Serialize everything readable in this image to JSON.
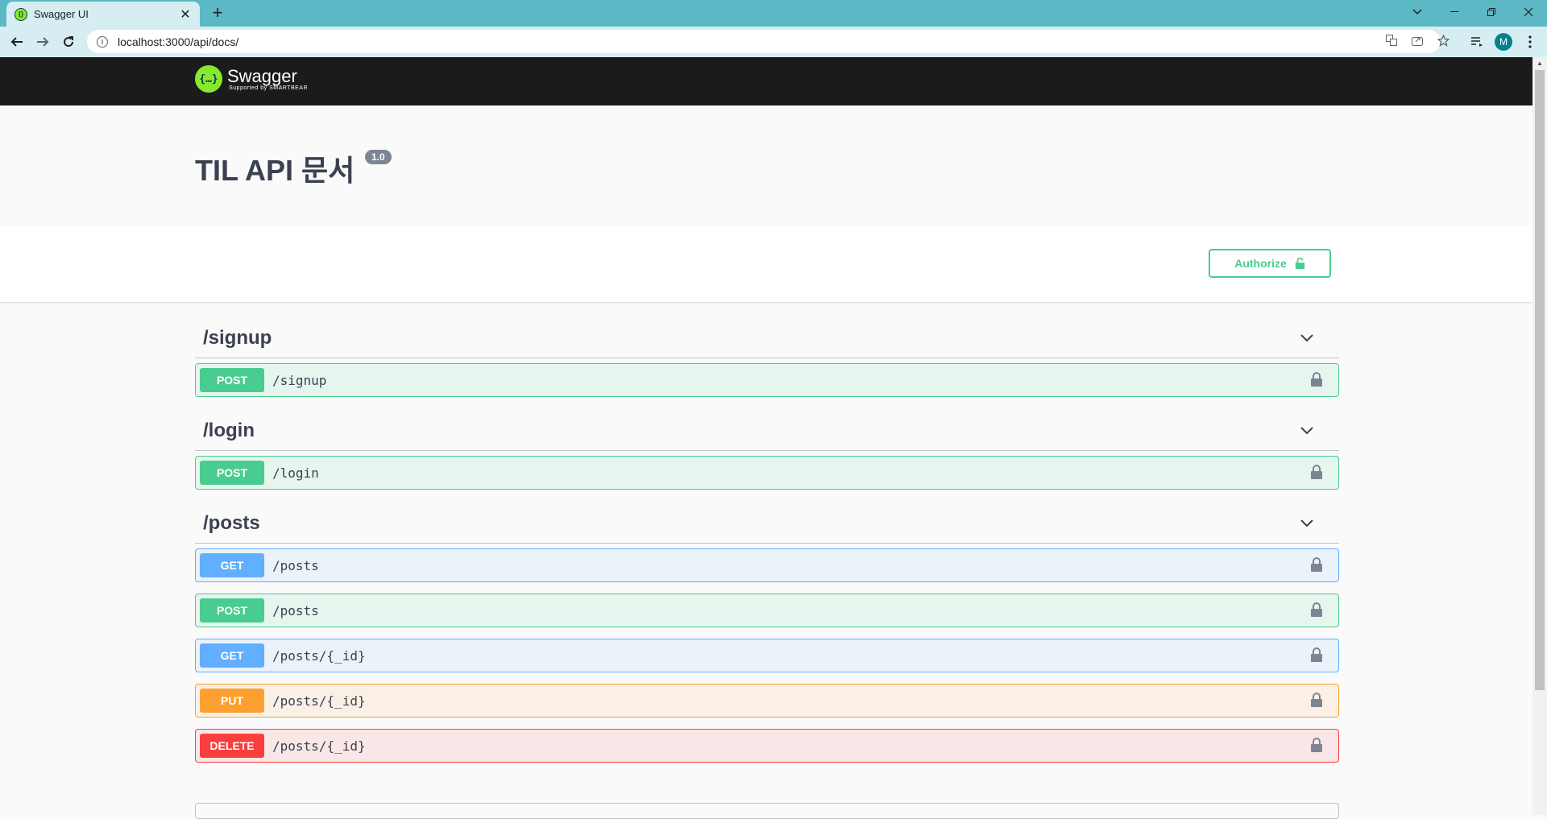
{
  "browser": {
    "tab_title": "Swagger UI",
    "tab_close": "✕",
    "new_tab": "+",
    "url": "localhost:3000/api/docs/",
    "profile_initial": "M"
  },
  "swagger": {
    "logo_name": "Swagger",
    "logo_sub": "Supported by SMARTBEAR",
    "title": "TIL API 문서",
    "version": "1.0",
    "authorize_label": "Authorize",
    "accent_post": "#49cc90",
    "accent_get": "#61affe",
    "accent_put": "#fca130",
    "accent_delete": "#f93e3e"
  },
  "tags": [
    {
      "name": "/signup",
      "ops": [
        {
          "method": "POST",
          "path": "/signup"
        }
      ]
    },
    {
      "name": "/login",
      "ops": [
        {
          "method": "POST",
          "path": "/login"
        }
      ]
    },
    {
      "name": "/posts",
      "ops": [
        {
          "method": "GET",
          "path": "/posts"
        },
        {
          "method": "POST",
          "path": "/posts"
        },
        {
          "method": "GET",
          "path": "/posts/{_id}"
        },
        {
          "method": "PUT",
          "path": "/posts/{_id}"
        },
        {
          "method": "DELETE",
          "path": "/posts/{_id}"
        }
      ]
    }
  ]
}
